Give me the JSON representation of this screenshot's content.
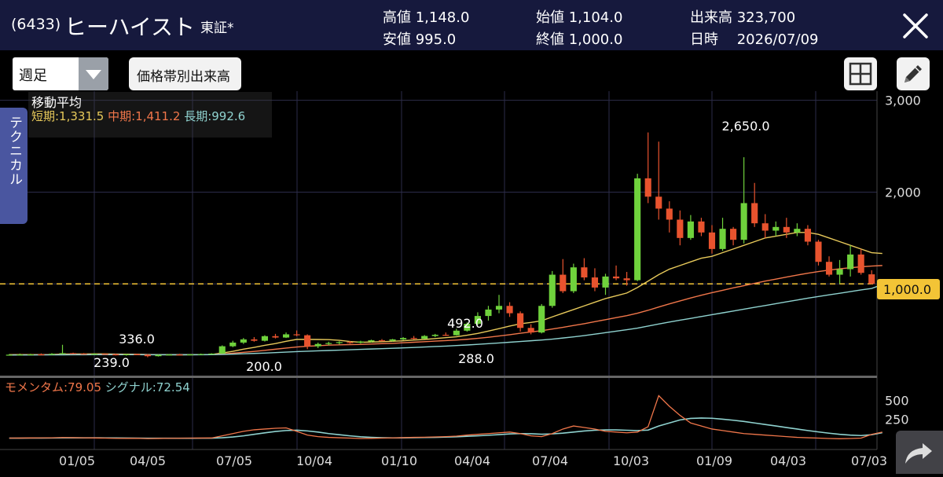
{
  "header": {
    "code": "(6433)",
    "name": "ヒーハイスト",
    "market": "東証*",
    "high": "高値 1,148.0",
    "low": "安値 995.0",
    "open": "始値 1,104.0",
    "close": "終値 1,000.0",
    "volume": "出来高 323,700",
    "date": "日時　 2026/07/09"
  },
  "toolbar": {
    "period": "週足",
    "volume_by_price_label": "価格帯別出来高"
  },
  "side_tab": "テクニカル",
  "ma_legend": {
    "title": "移動平均",
    "short": "短期:1,331.5",
    "mid": "中期:1,411.2",
    "long": "長期:992.6"
  },
  "momentum_legend": {
    "momentum": "モメンタム:79.05",
    "signal": "シグナル:72.54"
  },
  "current_price_label": "1,000.0",
  "colors": {
    "up": "#6fd23c",
    "down": "#e8532e",
    "ma_short": "#e7c95a",
    "ma_mid": "#f0764a",
    "ma_long": "#8fd2cf",
    "header_bg": "#16193d",
    "price_line": "#f3c436"
  },
  "icons": {
    "close": "close-icon",
    "grid": "grid-icon",
    "pencil": "pencil-icon",
    "share": "share-icon"
  },
  "chart_data": {
    "type": "candlestick",
    "price_axis": {
      "ylim": [
        0,
        3100
      ],
      "ticks": [
        "1,000",
        "2,000",
        "3,000"
      ]
    },
    "momentum_axis": {
      "ylim": [
        -150,
        700
      ],
      "ticks": [
        "250",
        "500"
      ]
    },
    "x_tick_labels": [
      "01/05",
      "04/05",
      "07/05",
      "10/04",
      "01/10",
      "04/04",
      "07/04",
      "10/03",
      "01/09",
      "04/03",
      "07/03"
    ],
    "current_price": 1000,
    "annotations": [
      {
        "label": "336.0",
        "value": 336
      },
      {
        "label": "239.0",
        "value": 239
      },
      {
        "label": "200.0",
        "value": 200
      },
      {
        "label": "492.0",
        "value": 492
      },
      {
        "label": "288.0",
        "value": 288
      },
      {
        "label": "2,650.0",
        "value": 2650
      }
    ],
    "candles": [
      {
        "o": 225,
        "h": 235,
        "l": 220,
        "c": 228
      },
      {
        "o": 228,
        "h": 240,
        "l": 224,
        "c": 230
      },
      {
        "o": 230,
        "h": 238,
        "l": 225,
        "c": 232
      },
      {
        "o": 232,
        "h": 242,
        "l": 226,
        "c": 229
      },
      {
        "o": 229,
        "h": 245,
        "l": 224,
        "c": 238
      },
      {
        "o": 238,
        "h": 336,
        "l": 232,
        "c": 245
      },
      {
        "o": 245,
        "h": 250,
        "l": 236,
        "c": 240
      },
      {
        "o": 240,
        "h": 246,
        "l": 232,
        "c": 236
      },
      {
        "o": 236,
        "h": 244,
        "l": 230,
        "c": 238
      },
      {
        "o": 238,
        "h": 242,
        "l": 228,
        "c": 232
      },
      {
        "o": 232,
        "h": 240,
        "l": 220,
        "c": 224
      },
      {
        "o": 224,
        "h": 238,
        "l": 218,
        "c": 234
      },
      {
        "o": 234,
        "h": 240,
        "l": 226,
        "c": 228
      },
      {
        "o": 228,
        "h": 234,
        "l": 200,
        "c": 212
      },
      {
        "o": 212,
        "h": 232,
        "l": 208,
        "c": 226
      },
      {
        "o": 226,
        "h": 236,
        "l": 222,
        "c": 230
      },
      {
        "o": 230,
        "h": 238,
        "l": 224,
        "c": 228
      },
      {
        "o": 228,
        "h": 236,
        "l": 222,
        "c": 232
      },
      {
        "o": 232,
        "h": 240,
        "l": 226,
        "c": 236
      },
      {
        "o": 236,
        "h": 244,
        "l": 232,
        "c": 240
      },
      {
        "o": 240,
        "h": 330,
        "l": 238,
        "c": 320
      },
      {
        "o": 320,
        "h": 380,
        "l": 310,
        "c": 360
      },
      {
        "o": 360,
        "h": 410,
        "l": 345,
        "c": 395
      },
      {
        "o": 395,
        "h": 420,
        "l": 370,
        "c": 380
      },
      {
        "o": 380,
        "h": 440,
        "l": 372,
        "c": 430
      },
      {
        "o": 430,
        "h": 455,
        "l": 405,
        "c": 415
      },
      {
        "o": 415,
        "h": 470,
        "l": 410,
        "c": 450
      },
      {
        "o": 450,
        "h": 492,
        "l": 430,
        "c": 440
      },
      {
        "o": 440,
        "h": 450,
        "l": 288,
        "c": 320
      },
      {
        "o": 320,
        "h": 360,
        "l": 300,
        "c": 345
      },
      {
        "o": 345,
        "h": 370,
        "l": 330,
        "c": 355
      },
      {
        "o": 355,
        "h": 375,
        "l": 340,
        "c": 365
      },
      {
        "o": 365,
        "h": 378,
        "l": 348,
        "c": 360
      },
      {
        "o": 360,
        "h": 380,
        "l": 350,
        "c": 372
      },
      {
        "o": 372,
        "h": 392,
        "l": 360,
        "c": 385
      },
      {
        "o": 385,
        "h": 398,
        "l": 372,
        "c": 380
      },
      {
        "o": 380,
        "h": 400,
        "l": 372,
        "c": 395
      },
      {
        "o": 395,
        "h": 420,
        "l": 386,
        "c": 410
      },
      {
        "o": 410,
        "h": 432,
        "l": 395,
        "c": 402
      },
      {
        "o": 402,
        "h": 442,
        "l": 398,
        "c": 432
      },
      {
        "o": 432,
        "h": 455,
        "l": 420,
        "c": 445
      },
      {
        "o": 445,
        "h": 470,
        "l": 432,
        "c": 440
      },
      {
        "o": 440,
        "h": 510,
        "l": 436,
        "c": 490
      },
      {
        "o": 490,
        "h": 580,
        "l": 480,
        "c": 565
      },
      {
        "o": 565,
        "h": 690,
        "l": 550,
        "c": 650
      },
      {
        "o": 650,
        "h": 760,
        "l": 600,
        "c": 720
      },
      {
        "o": 720,
        "h": 880,
        "l": 680,
        "c": 760
      },
      {
        "o": 760,
        "h": 800,
        "l": 640,
        "c": 680
      },
      {
        "o": 680,
        "h": 700,
        "l": 480,
        "c": 520
      },
      {
        "o": 520,
        "h": 560,
        "l": 450,
        "c": 470
      },
      {
        "o": 470,
        "h": 780,
        "l": 460,
        "c": 760
      },
      {
        "o": 760,
        "h": 1140,
        "l": 740,
        "c": 1100
      },
      {
        "o": 1100,
        "h": 1270,
        "l": 900,
        "c": 920
      },
      {
        "o": 920,
        "h": 1220,
        "l": 900,
        "c": 1180
      },
      {
        "o": 1180,
        "h": 1280,
        "l": 1040,
        "c": 1070
      },
      {
        "o": 1070,
        "h": 1170,
        "l": 920,
        "c": 960
      },
      {
        "o": 960,
        "h": 1110,
        "l": 880,
        "c": 1080
      },
      {
        "o": 1080,
        "h": 1200,
        "l": 1040,
        "c": 1060
      },
      {
        "o": 1060,
        "h": 1130,
        "l": 980,
        "c": 1040
      },
      {
        "o": 1040,
        "h": 2200,
        "l": 1030,
        "c": 2150
      },
      {
        "o": 2150,
        "h": 2650,
        "l": 1880,
        "c": 1950
      },
      {
        "o": 1950,
        "h": 2550,
        "l": 1700,
        "c": 1820
      },
      {
        "o": 1820,
        "h": 1900,
        "l": 1560,
        "c": 1700
      },
      {
        "o": 1700,
        "h": 1800,
        "l": 1420,
        "c": 1500
      },
      {
        "o": 1500,
        "h": 1750,
        "l": 1480,
        "c": 1680
      },
      {
        "o": 1680,
        "h": 1720,
        "l": 1520,
        "c": 1560
      },
      {
        "o": 1560,
        "h": 1640,
        "l": 1330,
        "c": 1380
      },
      {
        "o": 1380,
        "h": 1720,
        "l": 1360,
        "c": 1600
      },
      {
        "o": 1600,
        "h": 1620,
        "l": 1420,
        "c": 1480
      },
      {
        "o": 1480,
        "h": 2380,
        "l": 1440,
        "c": 1880
      },
      {
        "o": 1880,
        "h": 2100,
        "l": 1620,
        "c": 1660
      },
      {
        "o": 1660,
        "h": 1760,
        "l": 1500,
        "c": 1580
      },
      {
        "o": 1580,
        "h": 1680,
        "l": 1520,
        "c": 1620
      },
      {
        "o": 1620,
        "h": 1720,
        "l": 1500,
        "c": 1560
      },
      {
        "o": 1560,
        "h": 1660,
        "l": 1520,
        "c": 1600
      },
      {
        "o": 1600,
        "h": 1640,
        "l": 1420,
        "c": 1460
      },
      {
        "o": 1460,
        "h": 1480,
        "l": 1200,
        "c": 1240
      },
      {
        "o": 1240,
        "h": 1300,
        "l": 1080,
        "c": 1100
      },
      {
        "o": 1100,
        "h": 1260,
        "l": 1000,
        "c": 1160
      },
      {
        "o": 1160,
        "h": 1420,
        "l": 1080,
        "c": 1320
      },
      {
        "o": 1320,
        "h": 1380,
        "l": 1100,
        "c": 1120
      },
      {
        "o": 1104,
        "h": 1148,
        "l": 995,
        "c": 1000
      }
    ],
    "series": [
      {
        "name": "短期",
        "values": [
          228,
          229,
          230,
          230,
          231,
          235,
          236,
          236,
          237,
          237,
          235,
          234,
          233,
          230,
          229,
          228,
          227,
          228,
          229,
          231,
          247,
          265,
          288,
          308,
          330,
          350,
          374,
          395,
          395,
          394,
          392,
          385,
          372,
          363,
          366,
          370,
          374,
          380,
          388,
          394,
          404,
          414,
          423,
          440,
          460,
          485,
          512,
          540,
          565,
          580,
          598,
          640,
          680,
          720,
          760,
          800,
          840,
          870,
          900,
          960,
          1030,
          1100,
          1160,
          1200,
          1240,
          1280,
          1300,
          1340,
          1380,
          1420,
          1460,
          1500,
          1520,
          1540,
          1560,
          1560,
          1540,
          1500,
          1460,
          1420,
          1380,
          1340,
          1331.5
        ]
      },
      {
        "name": "中期",
        "values": [
          226,
          227,
          228,
          228,
          229,
          231,
          232,
          232,
          233,
          233,
          233,
          232,
          232,
          231,
          230,
          229,
          229,
          229,
          229,
          230,
          236,
          244,
          254,
          264,
          276,
          288,
          300,
          312,
          320,
          326,
          332,
          336,
          338,
          340,
          344,
          348,
          352,
          358,
          364,
          370,
          376,
          382,
          388,
          396,
          406,
          418,
          432,
          446,
          462,
          476,
          490,
          508,
          526,
          546,
          566,
          588,
          610,
          632,
          654,
          680,
          712,
          748,
          782,
          814,
          846,
          876,
          904,
          930,
          956,
          980,
          1006,
          1030,
          1052,
          1074,
          1096,
          1116,
          1134,
          1150,
          1164,
          1176,
          1186,
          1194,
          1200
        ]
      },
      {
        "name": "長期",
        "values": [
          224,
          225,
          225,
          226,
          226,
          227,
          228,
          228,
          229,
          229,
          229,
          229,
          229,
          228,
          228,
          228,
          228,
          228,
          228,
          229,
          231,
          234,
          238,
          242,
          246,
          251,
          256,
          262,
          266,
          270,
          274,
          278,
          282,
          286,
          290,
          294,
          298,
          302,
          307,
          312,
          317,
          322,
          328,
          334,
          341,
          348,
          356,
          364,
          372,
          380,
          388,
          398,
          410,
          422,
          436,
          452,
          468,
          484,
          500,
          518,
          540,
          562,
          584,
          604,
          624,
          644,
          664,
          684,
          704,
          724,
          744,
          764,
          784,
          804,
          824,
          844,
          862,
          880,
          898,
          916,
          934,
          950,
          992.6
        ]
      }
    ],
    "momentum": [
      0,
      1,
      2,
      3,
      4,
      8,
      6,
      4,
      2,
      0,
      -2,
      -3,
      -2,
      -6,
      -4,
      -2,
      -1,
      0,
      1,
      2,
      30,
      60,
      90,
      110,
      120,
      130,
      135,
      90,
      40,
      20,
      10,
      5,
      0,
      -5,
      -3,
      0,
      3,
      6,
      10,
      12,
      16,
      20,
      26,
      40,
      50,
      60,
      70,
      80,
      60,
      30,
      20,
      60,
      120,
      160,
      140,
      120,
      90,
      80,
      70,
      80,
      150,
      560,
      420,
      300,
      200,
      160,
      120,
      100,
      80,
      60,
      50,
      40,
      30,
      20,
      10,
      5,
      0,
      -5,
      -8,
      -5,
      0,
      50,
      79.05
    ],
    "signal": [
      0,
      0,
      1,
      1,
      2,
      3,
      4,
      4,
      4,
      3,
      2,
      1,
      0,
      -1,
      -2,
      -2,
      -2,
      -2,
      -1,
      0,
      5,
      15,
      30,
      50,
      70,
      88,
      100,
      105,
      95,
      80,
      60,
      45,
      30,
      18,
      10,
      5,
      3,
      4,
      6,
      8,
      10,
      14,
      18,
      24,
      30,
      38,
      46,
      55,
      60,
      58,
      52,
      56,
      66,
      80,
      94,
      104,
      108,
      108,
      104,
      100,
      106,
      160,
      200,
      240,
      260,
      265,
      262,
      250,
      236,
      220,
      200,
      180,
      160,
      140,
      120,
      100,
      82,
      65,
      50,
      40,
      34,
      45,
      72.54
    ],
    "momentum_label": "モメンタム",
    "signal_label": "シグナル"
  }
}
